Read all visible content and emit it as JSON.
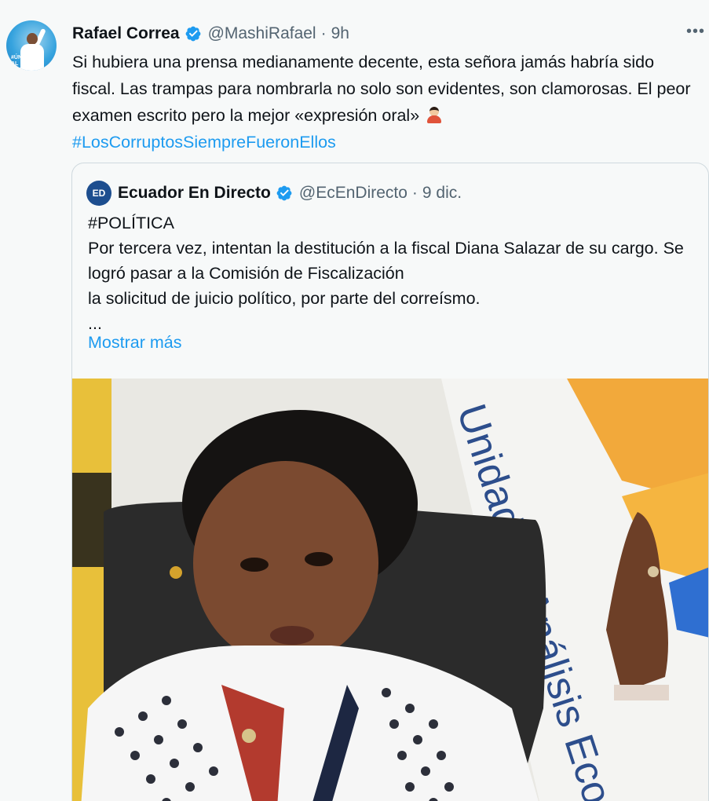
{
  "tweet": {
    "author_name": "Rafael Correa",
    "author_handle": "@MashiRafael",
    "separator": "·",
    "time": "9h",
    "more_label": "•••",
    "avatar_text": "#ÚNETE AL RC5",
    "text": "Si hubiera una prensa medianamente decente, esta señora jamás habría sido fiscal. Las trampas para nombrarla no solo son evidentes, son clamorosas. El peor examen escrito pero la mejor «expresión oral»",
    "hashtag": "#LosCorruptosSiempreFueronEllos",
    "emoji_icon": "person-facepalming-emoji"
  },
  "quoted": {
    "avatar_label": "ED",
    "author_name": "Ecuador En Directo",
    "author_handle": "@EcEnDirecto",
    "separator": "·",
    "time": "9 dic.",
    "line1": "#POLÍTICA",
    "line2": "Por tercera vez, intentan la destitución a la fiscal Diana Salazar de su cargo. Se logró pasar a la Comisión de Fiscalización",
    "line3": "la solicitud de juicio político, por parte del correísmo.",
    "line4": "...",
    "show_more": "Mostrar más",
    "image_banner_text": "Unidad de Análisis Eco",
    "image_alt": "photo of a woman speaking in an office"
  },
  "colors": {
    "link": "#1d9bf0",
    "verified": "#1d9bf0",
    "secondary_text": "#536471",
    "background": "#f7f9f9",
    "border": "#cfd9de"
  }
}
